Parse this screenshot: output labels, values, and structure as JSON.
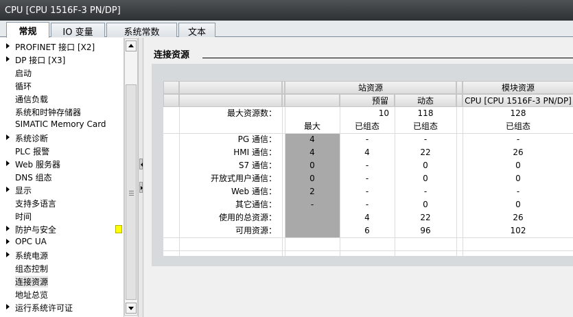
{
  "window": {
    "title": "CPU [CPU 1516F-3 PN/DP]"
  },
  "tabs": [
    {
      "label": "常规",
      "active": true
    },
    {
      "label": "IO 变量",
      "active": false
    },
    {
      "label": "系统常数",
      "active": false
    },
    {
      "label": "文本",
      "active": false
    }
  ],
  "sidebar": {
    "items": [
      {
        "label": "PROFINET 接口 [X2]",
        "expandable": true
      },
      {
        "label": "DP 接口 [X3]",
        "expandable": true
      },
      {
        "label": "启动",
        "expandable": false
      },
      {
        "label": "循环",
        "expandable": false
      },
      {
        "label": "通信负载",
        "expandable": false
      },
      {
        "label": "系统和时钟存储器",
        "expandable": false
      },
      {
        "label": "SIMATIC Memory Card",
        "expandable": false
      },
      {
        "label": "系统诊断",
        "expandable": true
      },
      {
        "label": "PLC 报警",
        "expandable": false
      },
      {
        "label": "Web 服务器",
        "expandable": true
      },
      {
        "label": "DNS 组态",
        "expandable": false
      },
      {
        "label": "显示",
        "expandable": true
      },
      {
        "label": "支持多语言",
        "expandable": false
      },
      {
        "label": "时间",
        "expandable": false
      },
      {
        "label": "防护与安全",
        "expandable": true,
        "warning": true
      },
      {
        "label": "OPC UA",
        "expandable": true
      },
      {
        "label": "系统电源",
        "expandable": true
      },
      {
        "label": "组态控制",
        "expandable": false
      },
      {
        "label": "连接资源",
        "expandable": false,
        "selected": true
      },
      {
        "label": "地址总览",
        "expandable": false
      },
      {
        "label": "运行系统许可证",
        "expandable": true
      }
    ]
  },
  "main": {
    "section_title": "连接资源",
    "table": {
      "group_station": "站资源",
      "group_module": "模块资源",
      "col_reserved": "预留",
      "col_dynamic": "动态",
      "col_module": "CPU [CPU 1516F-3 PN/DP]",
      "max_resources": {
        "label": "最大资源数：",
        "reserved": "10",
        "dynamic": "118",
        "module": "128"
      },
      "subheader": {
        "max": "最大",
        "reserved": "已组态",
        "dynamic": "已组态",
        "module": "已组态"
      },
      "rows": [
        {
          "label": "PG 通信：",
          "max": "4",
          "reserved": "-",
          "dynamic": "-",
          "module": "-"
        },
        {
          "label": "HMI 通信：",
          "max": "4",
          "reserved": "4",
          "dynamic": "22",
          "module": "26"
        },
        {
          "label": "S7 通信：",
          "max": "0",
          "reserved": "-",
          "dynamic": "0",
          "module": "0"
        },
        {
          "label": "开放式用户通信：",
          "max": "0",
          "reserved": "-",
          "dynamic": "0",
          "module": "0"
        },
        {
          "label": "Web 通信：",
          "max": "2",
          "reserved": "-",
          "dynamic": "-",
          "module": "-"
        },
        {
          "label": "其它通信：",
          "max": "-",
          "reserved": "-",
          "dynamic": "0",
          "module": "0"
        }
      ],
      "total": {
        "label": "使用的总资源：",
        "reserved": "4",
        "dynamic": "22",
        "module": "26"
      },
      "available": {
        "label": "可用资源：",
        "reserved": "6",
        "dynamic": "96",
        "module": "102"
      }
    }
  },
  "colors": {
    "titlebar": "#3c3f41",
    "selected_tab": "#ffffff",
    "gray_cell": "#a9a9a9",
    "warning": "#ffff00"
  }
}
